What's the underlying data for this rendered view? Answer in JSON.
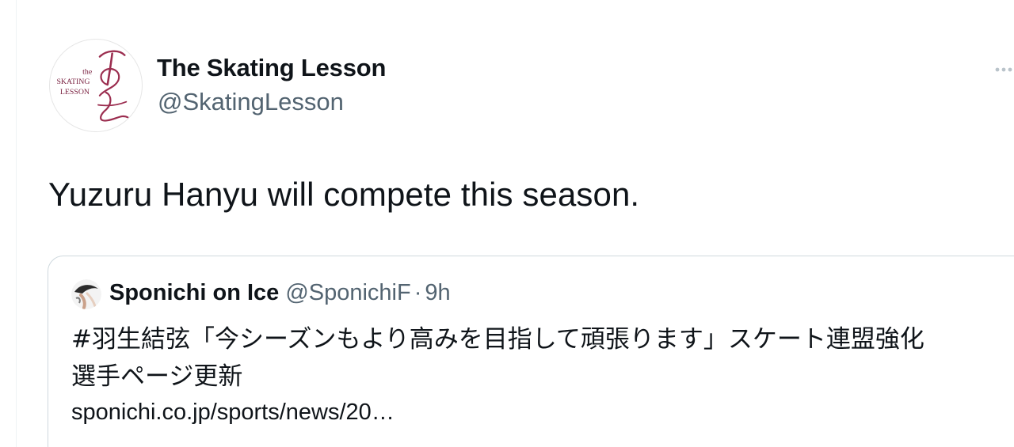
{
  "tweet": {
    "author": {
      "display_name": "The Skating Lesson",
      "handle": "@SkatingLesson",
      "avatar_text": [
        "the",
        "SKATING",
        "LESSON"
      ]
    },
    "text": "Yuzuru Hanyu will compete this season.",
    "more_icon": "ellipsis-icon"
  },
  "quoted_tweet": {
    "author": {
      "display_name": "Sponichi on Ice",
      "handle": "@SponichiF",
      "separator": "·",
      "time": "9h"
    },
    "text_line1": "#羽生結弦「今シーズンもより高みを目指して頑張ります」スケート連盟強化",
    "text_line2": "選手ページ更新",
    "link": "sponichi.co.jp/sports/news/20…"
  },
  "colors": {
    "primary_text": "#0f1419",
    "secondary_text": "#536471",
    "border": "#cfd9de",
    "logo_accent": "#9b2d4f"
  }
}
